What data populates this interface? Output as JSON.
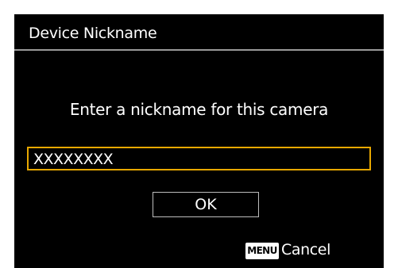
{
  "header": {
    "title": "Device Nickname"
  },
  "main": {
    "prompt": "Enter a nickname for this camera",
    "nickname_value": "XXXXXXXX",
    "ok_label": "OK"
  },
  "footer": {
    "menu_icon_label": "MENU",
    "menu_icon": "menu-button-icon",
    "cancel_label": "Cancel"
  },
  "colors": {
    "screen_background": "#000000",
    "text": "#ffffff",
    "title_divider": "#9a9a9a",
    "field_focus_border": "#e8a800",
    "button_border": "#bdbdbd"
  }
}
